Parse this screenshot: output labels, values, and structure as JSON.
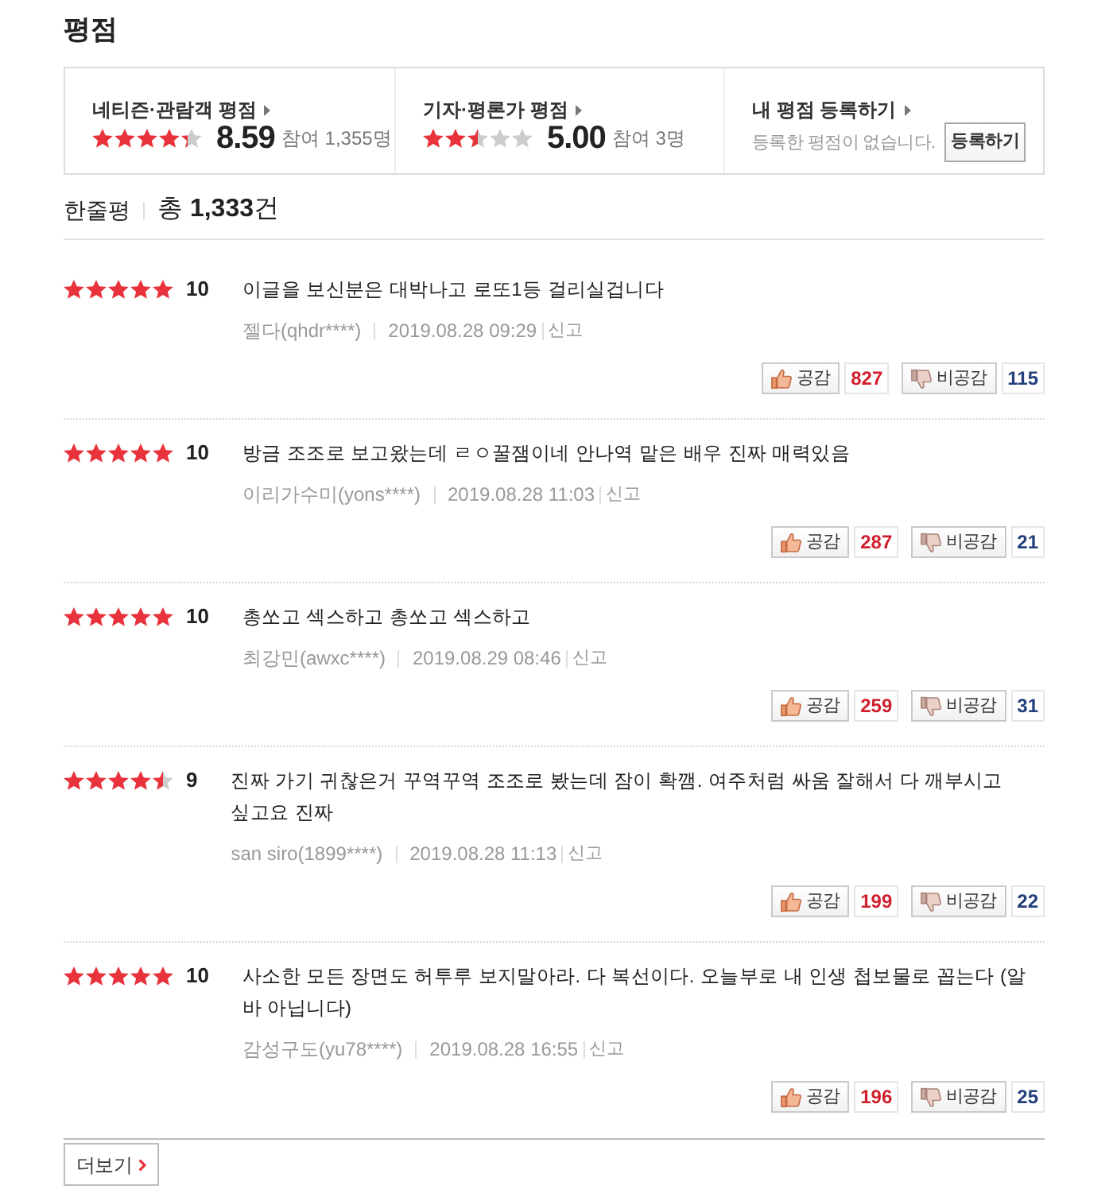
{
  "title": "평점",
  "score_panels": [
    {
      "kind": "rating",
      "label": "네티즌·관람객 평점",
      "stars": 4.3,
      "score": "8.59",
      "participants": "참여 1,355명"
    },
    {
      "kind": "rating",
      "label": "기자·평론가 평점",
      "stars": 2.5,
      "score": "5.00",
      "participants": "참여 3명"
    },
    {
      "kind": "register",
      "label": "내 평점 등록하기",
      "message": "등록한 평점이 없습니다.",
      "button": "등록하기"
    }
  ],
  "reviews_header": {
    "label": "한줄평",
    "total": "총 **1,333**건"
  },
  "reviews": [
    {
      "stars": 5,
      "score": "10",
      "text": "이글을 보신분은 대박나고 로또1등 걸리실겁니다",
      "author": "젤다(qhdr****)",
      "date": "2019.08.28 09:29",
      "report": "신고",
      "like_label": "공감",
      "likes": "827",
      "dislike_label": "비공감",
      "dislikes": "115"
    },
    {
      "stars": 5,
      "score": "10",
      "text": "방금 조조로 보고왔는데 ㄹㅇ꿀잼이네 안나역 맡은 배우 진짜 매력있음",
      "author": "이리가수미(yons****)",
      "date": "2019.08.28 11:03",
      "report": "신고",
      "like_label": "공감",
      "likes": "287",
      "dislike_label": "비공감",
      "dislikes": "21"
    },
    {
      "stars": 5,
      "score": "10",
      "text": "총쏘고 섹스하고 총쏘고 섹스하고",
      "author": "최강민(awxc****)",
      "date": "2019.08.29 08:46",
      "report": "신고",
      "like_label": "공감",
      "likes": "259",
      "dislike_label": "비공감",
      "dislikes": "31"
    },
    {
      "stars": 4.5,
      "score": "9",
      "text": "진짜 가기 귀찮은거 꾸역꾸역 조조로 봤는데 잠이 확깸. 여주처럼 싸움 잘해서 다 깨부시고 싶고요 진짜",
      "author": "san siro(1899****)",
      "date": "2019.08.28 11:13",
      "report": "신고",
      "like_label": "공감",
      "likes": "199",
      "dislike_label": "비공감",
      "dislikes": "22"
    },
    {
      "stars": 5,
      "score": "10",
      "text": "사소한 모든 장면도 허투루 보지말아라. 다 복선이다. 오늘부로 내 인생 첩보물로 꼽는다 (알바 아닙니다)",
      "author": "감성구도(yu78****)",
      "date": "2019.08.28 16:55",
      "report": "신고",
      "like_label": "공감",
      "likes": "196",
      "dislike_label": "비공감",
      "dislikes": "25"
    }
  ],
  "more_button": "더보기"
}
